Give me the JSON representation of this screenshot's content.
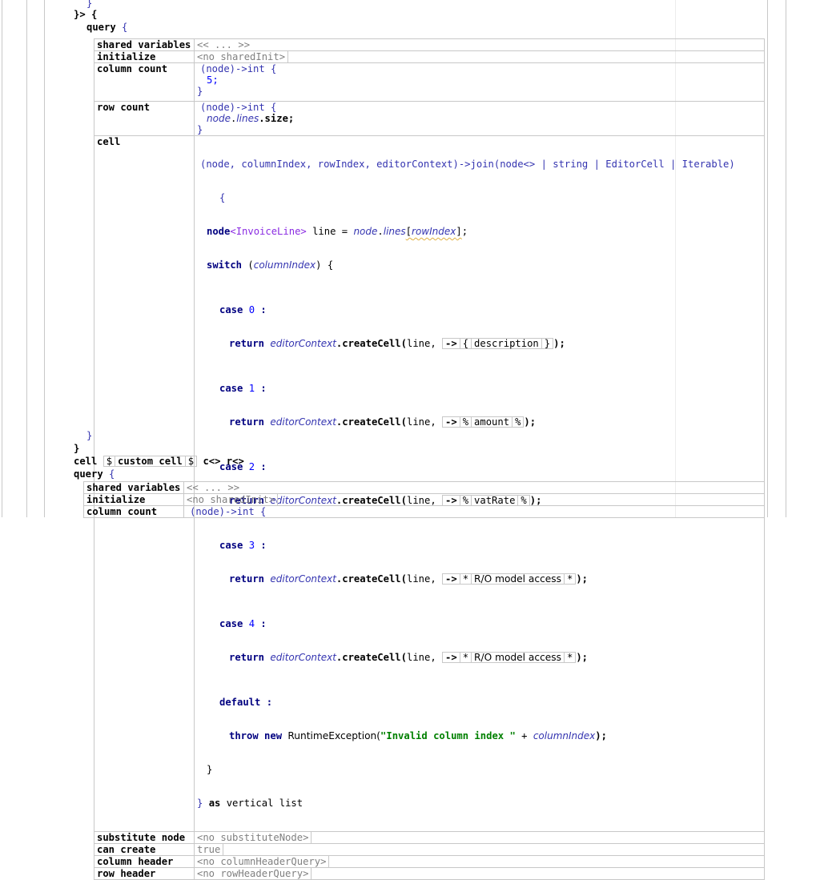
{
  "code": {
    "closing_brace_top": "}",
    "tail_open": "}> {",
    "query_kw": "query",
    "open_brace": "{",
    "close_brace": "}",
    "close_angle_brace": "}"
  },
  "table1": {
    "rows": {
      "shared_variables": {
        "label": "shared variables",
        "value": "<< ... >>"
      },
      "initialize": {
        "label": "initialize",
        "value": "<no sharedInit>"
      },
      "column_count": {
        "label": "column count",
        "sig": "(node)->int {",
        "body": "5;",
        "end": "}"
      },
      "row_count": {
        "label": "row count",
        "sig": "(node)->int {",
        "body_obj": "node",
        "body_field": "lines",
        "body_op": ".size;",
        "end": "}"
      },
      "cell": {
        "label": "cell",
        "sig": "(node, columnIndex, rowIndex, editorContext)->join(node<> | string | EditorCell | Iterable)",
        "open": "{",
        "decl_kw": "node",
        "decl_type": "<InvoiceLine>",
        "decl_rest": " line = ",
        "decl_obj": "node",
        "decl_field": "lines",
        "decl_idx": "rowIndex",
        "switch_kw": "switch",
        "switch_arg": "columnIndex",
        "cases": [
          {
            "kw": "case",
            "num": "0",
            "arrow": "->",
            "open": "{",
            "prop": "description",
            "close": "}"
          },
          {
            "kw": "case",
            "num": "1",
            "arrow": "->",
            "open": "%",
            "prop": "amount",
            "close": "%"
          },
          {
            "kw": "case",
            "num": "2",
            "arrow": "->",
            "open": "%",
            "prop": "vatRate",
            "close": "%"
          },
          {
            "kw": "case",
            "num": "3",
            "arrow": "->",
            "open": "*",
            "prop": "R/O model access",
            "close": "*"
          },
          {
            "kw": "case",
            "num": "4",
            "arrow": "->",
            "open": "*",
            "prop": "R/O model access",
            "close": "*"
          }
        ],
        "return_kw": "return",
        "ctx": "editorContext",
        "method": ".createCell(",
        "arg": "line,",
        "end_call": ");",
        "default_kw": "default",
        "throw_kw": "throw new",
        "exc": "RuntimeException(",
        "exc_str": "\"Invalid column index \"",
        "exc_plus": " + ",
        "exc_arg": "columnIndex",
        "exc_end": ");",
        "as_kw": "as",
        "layout": "vertical list"
      },
      "substitute_node": {
        "label": "substitute node",
        "value": "<no substituteNode>"
      },
      "can_create": {
        "label": "can create",
        "value": "true"
      },
      "column_header": {
        "label": "column header",
        "value": "<no columnHeaderQuery>"
      },
      "row_header": {
        "label": "row header",
        "value": "<no rowHeaderQuery>"
      }
    }
  },
  "cell_decl": {
    "kw": "cell",
    "delim_open": "$",
    "name": "custom cell",
    "delim_close": "$",
    "rest": "c<> r<>"
  },
  "table2": {
    "rows": {
      "shared_variables": {
        "label": "shared variables",
        "value": "<< ... >>"
      },
      "initialize": {
        "label": "initialize",
        "value": "<no sharedInit>"
      },
      "column_count": {
        "label": "column count",
        "sig": "(node)->int {"
      }
    }
  }
}
